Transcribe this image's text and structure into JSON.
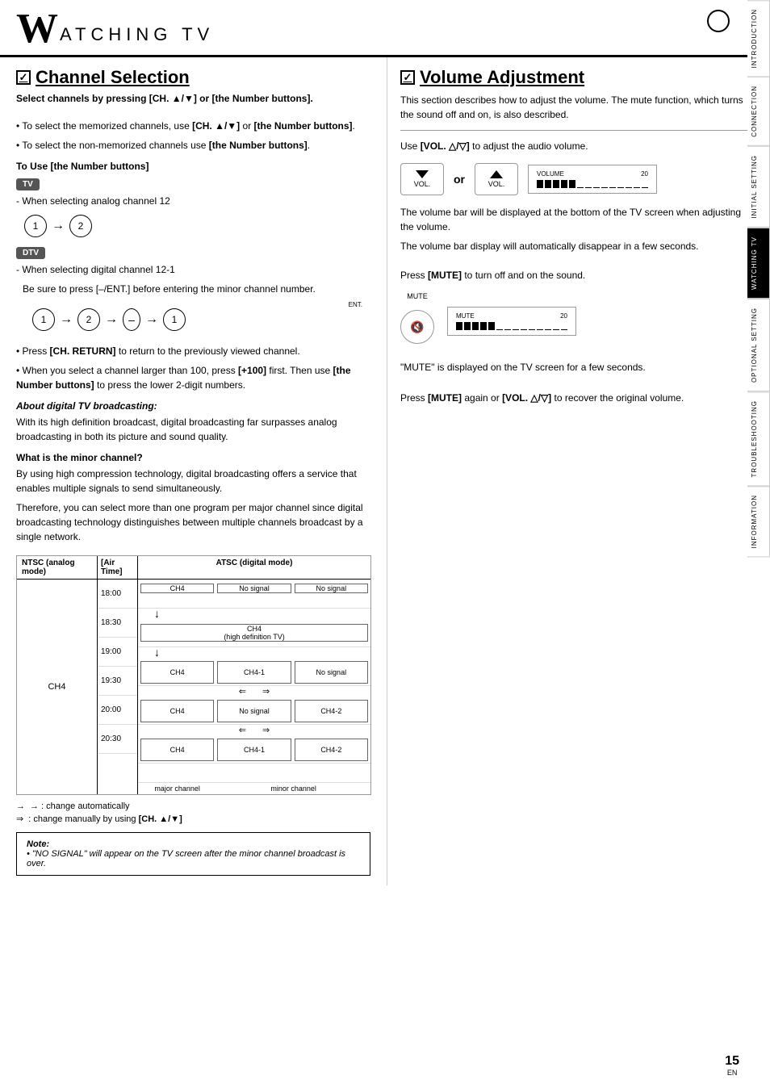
{
  "header": {
    "w": "W",
    "title": "ATCHING  TV",
    "circle": true
  },
  "side_tabs": [
    {
      "label": "INTRODUCTION",
      "active": false
    },
    {
      "label": "CONNECTION",
      "active": false
    },
    {
      "label": "INITIAL SETTING",
      "active": false
    },
    {
      "label": "WATCHING TV",
      "active": true
    },
    {
      "label": "OPTIONAL SETTING",
      "active": false
    },
    {
      "label": "TROUBLESHOOTING",
      "active": false
    },
    {
      "label": "INFORMATION",
      "active": false
    }
  ],
  "left": {
    "section_title": "Channel Selection",
    "subtitle": "Select channels by pressing [CH. ▲/▼] or [the Number buttons].",
    "bullets": [
      "To select the memorized channels, use [CH. ▲/▼] or [the Number buttons].",
      "To select the non-memorized channels use [the Number buttons]."
    ],
    "number_buttons_heading": "To Use [the Number buttons]",
    "tv_badge": "TV",
    "analog_text": "- When selecting analog channel 12",
    "dtv_badge": "DTV",
    "digital_text": "- When selecting digital channel 12-1",
    "digital_note": "Be sure to press [–/ENT.] before entering the minor channel number.",
    "ent_label": "ENT.",
    "more_bullets": [
      "Press [CH. RETURN] to return to the previously viewed channel.",
      "When you select a channel larger than 100, press [+100] first. Then use [the Number buttons] to press the lower 2-digit numbers."
    ],
    "about_heading": "About digital TV broadcasting:",
    "about_text": "With its high definition broadcast, digital broadcasting far surpasses analog broadcasting in both its picture and sound quality.",
    "minor_heading": "What is the minor channel?",
    "minor_text1": "By using high compression technology, digital broadcasting offers a service that enables multiple signals to send simultaneously.",
    "minor_text2": "Therefore, you can select more than one program per major channel since digital broadcasting technology distinguishes between multiple channels broadcast by a single network.",
    "chart": {
      "ntsc_header": "NTSC (analog mode)",
      "air_header": "[Air Time]",
      "atsc_header": "ATSC (digital mode)",
      "ch_label": "CH4",
      "times": [
        "18:00",
        "18:30",
        "19:00",
        "19:30",
        "20:00",
        "20:30"
      ],
      "rows": [
        {
          "time": "18:00",
          "cells": [
            {
              "label": "CH4",
              "w": 1
            },
            {
              "label": "No signal",
              "w": 1
            },
            {
              "label": "No signal",
              "w": 1
            }
          ],
          "arrow": "down"
        },
        {
          "time": "18:30",
          "cells": [
            {
              "label": "CH4\n(high definition TV)",
              "w": 3,
              "merged": true
            }
          ],
          "arrow": "down"
        },
        {
          "time": "19:00",
          "cells": [
            {
              "label": "CH4",
              "w": 1
            },
            {
              "label": "CH4-1",
              "w": 1
            },
            {
              "label": "No signal",
              "w": 1
            }
          ],
          "arrow": "down_lr"
        },
        {
          "time": "19:30",
          "cells": [
            {
              "label": "CH4",
              "w": 1
            },
            {
              "label": "No signal",
              "w": 1
            },
            {
              "label": "CH4-2",
              "w": 1
            }
          ],
          "arrow": "lr"
        },
        {
          "time": "20:00",
          "cells": [
            {
              "label": "CH4",
              "w": 1
            },
            {
              "label": "CH4-1",
              "w": 1
            },
            {
              "label": "CH4-2",
              "w": 1
            }
          ],
          "arrow": ""
        },
        {
          "time": "20:30",
          "cells": [],
          "bottom": true
        }
      ],
      "legend_auto": "→ : change automatically",
      "legend_manual": "⇒ : change manually by using [CH. ▲/▼]",
      "major_label": "major channel",
      "minor_label": "minor channel"
    },
    "note_title": "Note:",
    "note_text": "• \"NO SIGNAL\" will appear on the TV screen after the minor channel broadcast is over."
  },
  "right": {
    "section_title": "Volume Adjustment",
    "intro": "This section describes how to adjust the volume. The mute function, which turns the sound off and on, is also described.",
    "vol_use_text": "Use [VOL. △/▽] to adjust the audio volume.",
    "vol_label": "VOL.",
    "vol_number": "20",
    "vol_volume_label": "VOLUME",
    "vol_bullets": [
      "The volume bar will be displayed at the bottom of the TV screen when adjusting the volume.",
      "The volume bar display will automatically disappear in a few seconds."
    ],
    "mute_press": "Press [MUTE] to turn off and on the sound.",
    "mute_label": "MUTE",
    "mute_number": "20",
    "mute_bullets": [
      "\"MUTE\" is displayed on the TV screen for a few seconds."
    ],
    "recover_text": "Press [MUTE] again or [VOL. △/▽] to recover the original volume."
  },
  "page": {
    "number": "15",
    "lang": "EN"
  }
}
